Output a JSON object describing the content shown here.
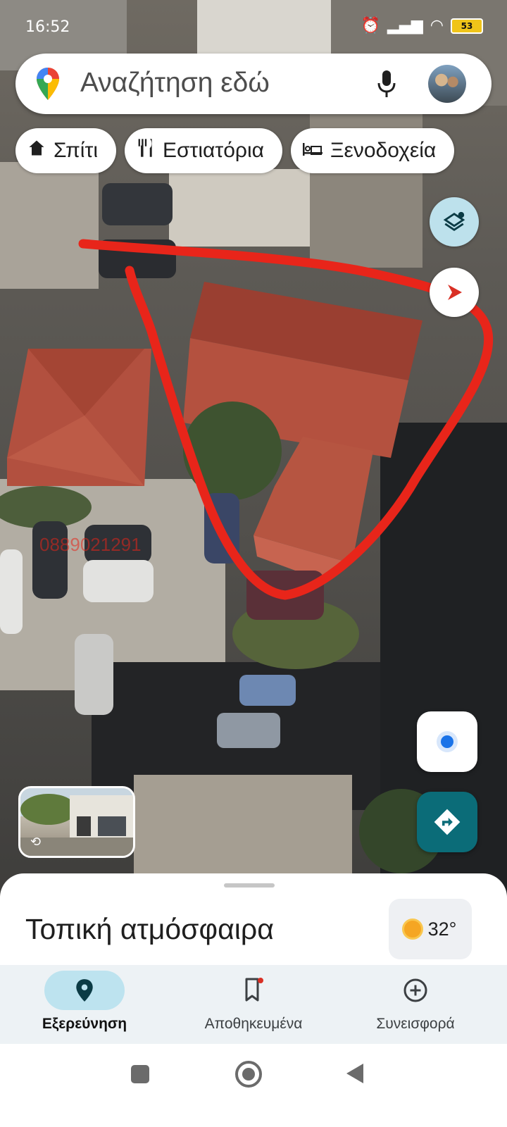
{
  "status_bar": {
    "time": "16:52",
    "battery": "53"
  },
  "search": {
    "placeholder": "Αναζήτηση εδώ"
  },
  "chips": [
    {
      "icon": "home-icon",
      "label": "Σπίτι"
    },
    {
      "icon": "restaurant-icon",
      "label": "Εστιατόρια"
    },
    {
      "icon": "hotel-icon",
      "label": "Ξενοδοχεία"
    }
  ],
  "map": {
    "watermark": "0889021291",
    "annotation": "red-freehand-outline"
  },
  "sheet": {
    "title": "Τοπική ατμόσφαιρα",
    "weather": {
      "icon": "sun-icon",
      "temp": "32°"
    }
  },
  "bottom_nav": [
    {
      "icon": "explore-pin-icon",
      "label": "Εξερεύνηση",
      "active": true
    },
    {
      "icon": "bookmark-icon",
      "label": "Αποθηκευμένα",
      "active": false
    },
    {
      "icon": "add-circle-icon",
      "label": "Συνεισφορά",
      "active": false
    }
  ],
  "colors": {
    "accent": "#0b6c78",
    "annotation_red": "#e8251a",
    "active_tab": "#bde3ef"
  }
}
